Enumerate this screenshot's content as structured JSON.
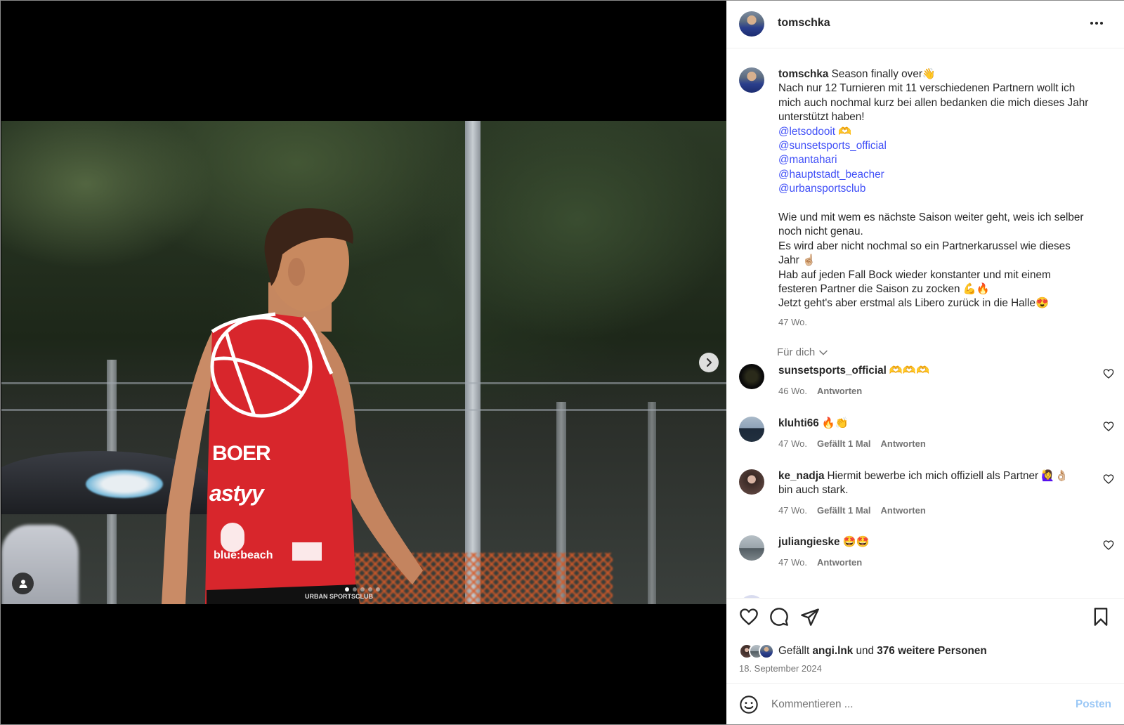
{
  "post": {
    "username": "tomschka",
    "caption": {
      "username": "tomschka",
      "first_line": "Season finally over👋",
      "lines_a": [
        "Nach nur 12 Turnieren mit 11 verschiedenen Partnern wollt ich",
        "mich auch nochmal kurz bei allen bedanken die mich dieses Jahr",
        "unterstützt haben!"
      ],
      "mentions": [
        "@letsodooit 🫶",
        "@sunsetsports_official",
        "@mantahari",
        "@hauptstadt_beacher",
        "@urbansportsclub"
      ],
      "lines_b": [
        "Wie und mit wem es nächste Saison weiter geht, weis ich selber",
        "noch nicht genau.",
        "Es wird aber nicht nochmal so ein Partnerkarussel wie dieses",
        "Jahr ☝🏼",
        "Hab auf jeden Fall Bock wieder konstanter und mit einem",
        "festeren Partner die Saison zu zocken 💪🔥",
        "Jetzt geht's aber erstmal als Libero zurück in die Halle😍"
      ],
      "time": "47 Wo."
    },
    "sort_label": "Für dich",
    "comments": [
      {
        "user": "sunsetsports_official",
        "text": "🫶🫶🫶",
        "time": "46 Wo.",
        "likes": "",
        "reply": "Antworten"
      },
      {
        "user": "kluhti66",
        "text": "🔥👏",
        "time": "47 Wo.",
        "likes": "Gefällt 1 Mal",
        "reply": "Antworten"
      },
      {
        "user": "ke_nadja",
        "text": "Hiermit bewerbe ich mich offiziell als Partner 🙋‍♀️👌🏼 bin auch stark.",
        "time": "47 Wo.",
        "likes": "Gefällt 1 Mal",
        "reply": "Antworten"
      },
      {
        "user": "juliangieske",
        "text": "🤩🤩",
        "time": "47 Wo.",
        "likes": "",
        "reply": "Antworten"
      }
    ],
    "likes": {
      "prefix": "Gefällt",
      "first_liker": "angi.lnk",
      "joiner": "und",
      "others": "376 weitere Personen"
    },
    "date": "18. September 2024",
    "comment_input": {
      "placeholder": "Kommentieren ..."
    },
    "post_button": "Posten"
  },
  "media": {
    "jersey_texts": [
      "BOER",
      "astyy",
      "blue:beach",
      "URBAN SPORTSCLUB"
    ],
    "carousel": {
      "count": 5,
      "active_index": 0
    }
  },
  "icons": {
    "more": "more-horizontal-icon",
    "next": "chevron-right-icon",
    "user_tag": "person-icon",
    "like": "heart-icon",
    "comment": "comment-bubble-icon",
    "share": "paper-plane-icon",
    "save": "bookmark-icon",
    "emoji": "smiley-icon",
    "sort": "chevron-down-icon"
  },
  "colors": {
    "link": "#4150f7",
    "muted": "#737373",
    "post_button_disabled": "#9bc8f6",
    "jersey_red": "#d8262c"
  }
}
